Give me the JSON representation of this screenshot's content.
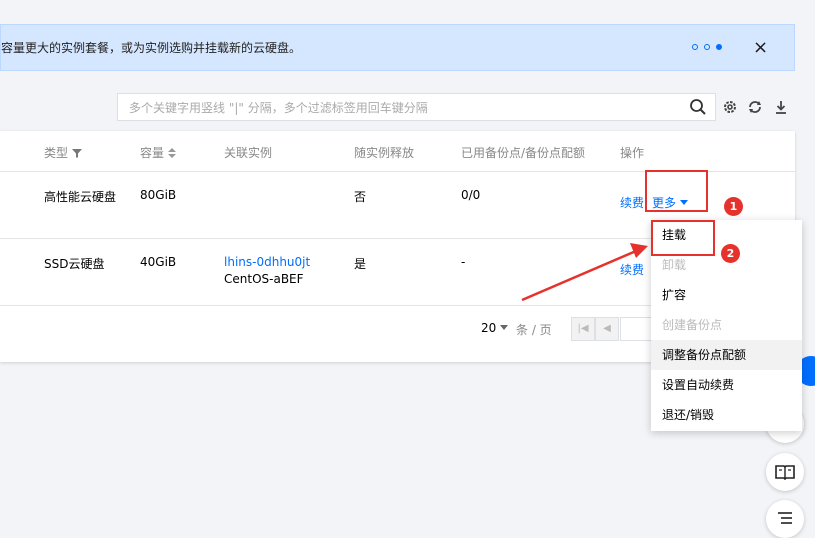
{
  "banner": {
    "text": "容量更大的实例套餐，或为实例选购并挂载新的云硬盘。",
    "close_icon": "×"
  },
  "search": {
    "placeholder": "多个关键字用竖线 \"|\" 分隔，多个过滤标签用回车键分隔"
  },
  "table": {
    "headers": {
      "type": "类型",
      "capacity": "容量",
      "instance": "关联实例",
      "release": "随实例释放",
      "backup": "已用备份点/备份点配额",
      "ops": "操作"
    },
    "rows": [
      {
        "type": "高性能云硬盘",
        "capacity": "80GiB",
        "instance_id": "",
        "instance_name": "",
        "release": "否",
        "backup": "0/0",
        "renew": "续费",
        "more": "更多"
      },
      {
        "type": "SSD云硬盘",
        "capacity": "40GiB",
        "instance_id": "lhins-0dhhu0jt",
        "instance_name": "CentOS-aBEF",
        "release": "是",
        "backup": "-",
        "renew": "续费"
      }
    ]
  },
  "pager": {
    "page_size": "20",
    "unit": "条 / 页"
  },
  "menu": {
    "items": [
      {
        "label": "挂载",
        "disabled": false
      },
      {
        "label": "卸载",
        "disabled": true
      },
      {
        "label": "扩容",
        "disabled": false
      },
      {
        "label": "创建备份点",
        "disabled": true
      },
      {
        "label": "调整备份点配额",
        "disabled": false
      },
      {
        "label": "设置自动续费",
        "disabled": false
      },
      {
        "label": "退还/销毁",
        "disabled": false
      }
    ]
  },
  "annotations": {
    "badge1": "1",
    "badge2": "2",
    "color": "#e5322d"
  },
  "colors": {
    "accent": "#006eff",
    "banner_bg": "#d5e7ff"
  }
}
